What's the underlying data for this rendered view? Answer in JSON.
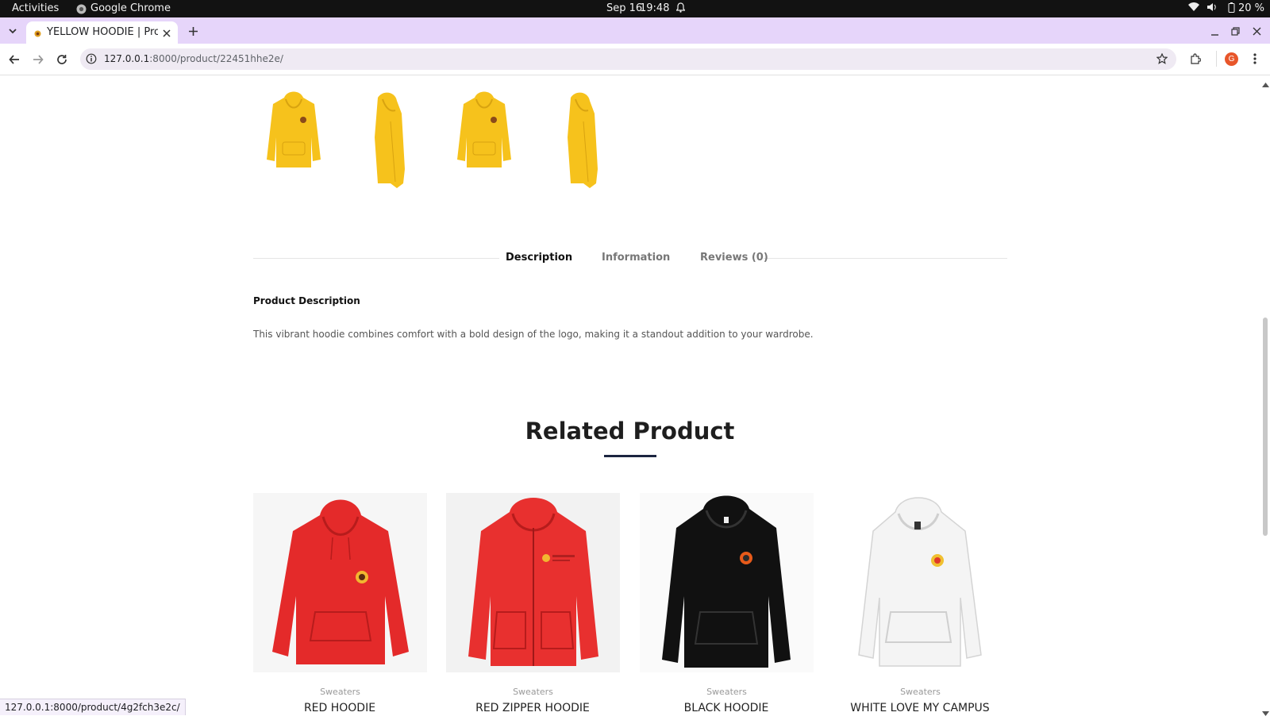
{
  "system_bar": {
    "activities": "Activities",
    "app_name": "Google Chrome",
    "date": "Sep 16",
    "time": "19:48",
    "battery": "20 %"
  },
  "browser": {
    "tab_title": "YELLOW HOODIE | Produ",
    "url_host": "127.0.0.1",
    "url_rest": ":8000/product/22451hhe2e/",
    "profile_initial": "G",
    "status_url": "127.0.0.1:8000/product/4g2fch3e2c/",
    "accent": "#e6d5fa"
  },
  "gallery": {
    "thumbnails": [
      {
        "view": "front",
        "color": "#f6c21c"
      },
      {
        "view": "side",
        "color": "#f6c21c"
      },
      {
        "view": "front",
        "color": "#f6c21c"
      },
      {
        "view": "side",
        "color": "#f6c21c"
      }
    ]
  },
  "product_tabs": {
    "items": [
      "Description",
      "Information",
      "Reviews (0)"
    ],
    "active": "Description"
  },
  "description": {
    "heading": "Product Description",
    "text": "This vibrant hoodie combines comfort with a bold design of the logo, making it a standout addition to your wardrobe."
  },
  "related": {
    "title": "Related Product",
    "products": [
      {
        "category": "Sweaters",
        "name": "RED HOODIE",
        "color": "#e42a2a",
        "style": "pullover"
      },
      {
        "category": "Sweaters",
        "name": "RED ZIPPER HOODIE",
        "color": "#e8302f",
        "style": "zipper"
      },
      {
        "category": "Sweaters",
        "name": "BLACK HOODIE",
        "color": "#111111",
        "style": "pullover"
      },
      {
        "category": "Sweaters",
        "name": "WHITE LOVE MY CAMPUS",
        "color": "#f4f4f4",
        "style": "pullover"
      }
    ]
  }
}
